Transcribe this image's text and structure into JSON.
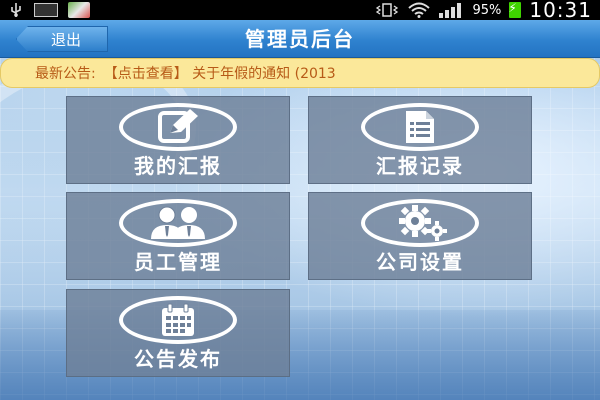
{
  "status_bar": {
    "battery": "95%",
    "time": "10:31",
    "icons": [
      "usb-icon",
      "keyboard-icon",
      "map-icon",
      "vibrate-icon",
      "wifi-icon",
      "signal-icon",
      "battery-charging-icon"
    ]
  },
  "header": {
    "back_label": "退出",
    "title": "管理员后台"
  },
  "notice": {
    "label": "最新公告:",
    "text": "【点击查看】 关于年假的通知 (2013"
  },
  "tiles": [
    {
      "label": "我的汇报",
      "icon": "edit-icon"
    },
    {
      "label": "汇报记录",
      "icon": "document-icon"
    },
    {
      "label": "员工管理",
      "icon": "users-icon"
    },
    {
      "label": "公司设置",
      "icon": "gears-icon"
    },
    {
      "label": "公告发布",
      "icon": "calendar-icon"
    }
  ],
  "colors": {
    "title_bar": "#2f82cf",
    "notice_bg": "#fbe89a",
    "notice_text": "#b75a17",
    "tile_bg": "#6e8098"
  }
}
